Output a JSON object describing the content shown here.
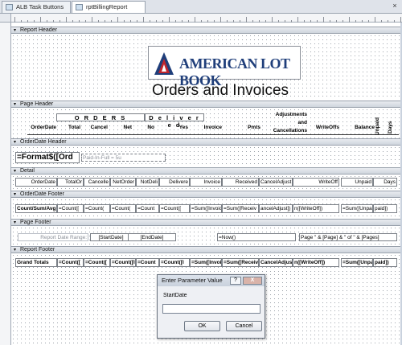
{
  "tabs": [
    {
      "label": "ALB Task Buttons",
      "active": false
    },
    {
      "label": "rptBillingReport",
      "active": true
    }
  ],
  "tab_close_glyph": "×",
  "sections": {
    "report_header": "Report Header",
    "page_header": "Page Header",
    "orderdate_header": "OrderDate Header",
    "detail": "Detail",
    "orderdate_footer": "OrderDate Footer",
    "page_footer": "Page Footer",
    "report_footer": "Report Footer"
  },
  "report_header": {
    "logo_text": "AMERICAN LOT BOOK",
    "title": "Orders and Invoices"
  },
  "page_header": {
    "group_orders": "O R D E R S",
    "group_delivered": "D e l i v e r e d",
    "columns": [
      "OrderDate",
      "Total",
      "Cancel",
      "Net",
      "No",
      "Yes",
      "Invoice",
      "Pmts",
      "Adjustments and Cancellations",
      "WriteOffs",
      "Balance",
      "Unpaid",
      "Days"
    ]
  },
  "orderdate_header": {
    "format_field": "=Format$([Ord",
    "paid_field": "Paid-In-Full = 5u"
  },
  "detail": {
    "fields": [
      "OrderDate",
      "TotalOr",
      "Cancelle",
      "NetOrder",
      "NotDeli",
      "Delivere",
      "Invoice",
      "Received",
      "CancelAdjust",
      "WriteOff",
      "Unpaid",
      "Days"
    ]
  },
  "orderdate_footer": {
    "fields": [
      "Count/Sum/Avg",
      "=Count([",
      "=Count(",
      "=Count(",
      "=Count",
      "=Count([",
      "=Sum([Invoic",
      "=Sum([Receiv",
      "ancelAdjust])",
      "n([WriteOff])",
      "=Sum([Unpaid",
      "paid])"
    ]
  },
  "page_footer": {
    "report_date_range": "Report Date Range:",
    "start_date": "[StartDate]",
    "end_date": "[EndDate]",
    "now": "=Now()",
    "page_expr": "Page \" & [Page] & \" of \" & [Pages]"
  },
  "report_footer": {
    "fields": [
      "Grand Totals",
      "=Count([",
      "=Count([",
      "=Count([I",
      "=Count",
      "=Count([I",
      "=Sum([Invoic",
      "=Sum([Receiv",
      "CancelAdjust]",
      "n([WriteOff])",
      "=Sum([Unpaid",
      "paid])"
    ]
  },
  "dialog": {
    "title": "Enter Parameter Value",
    "help_glyph": "?",
    "close_glyph": "X",
    "label": "StartDate",
    "value": "",
    "ok": "OK",
    "cancel": "Cancel"
  }
}
